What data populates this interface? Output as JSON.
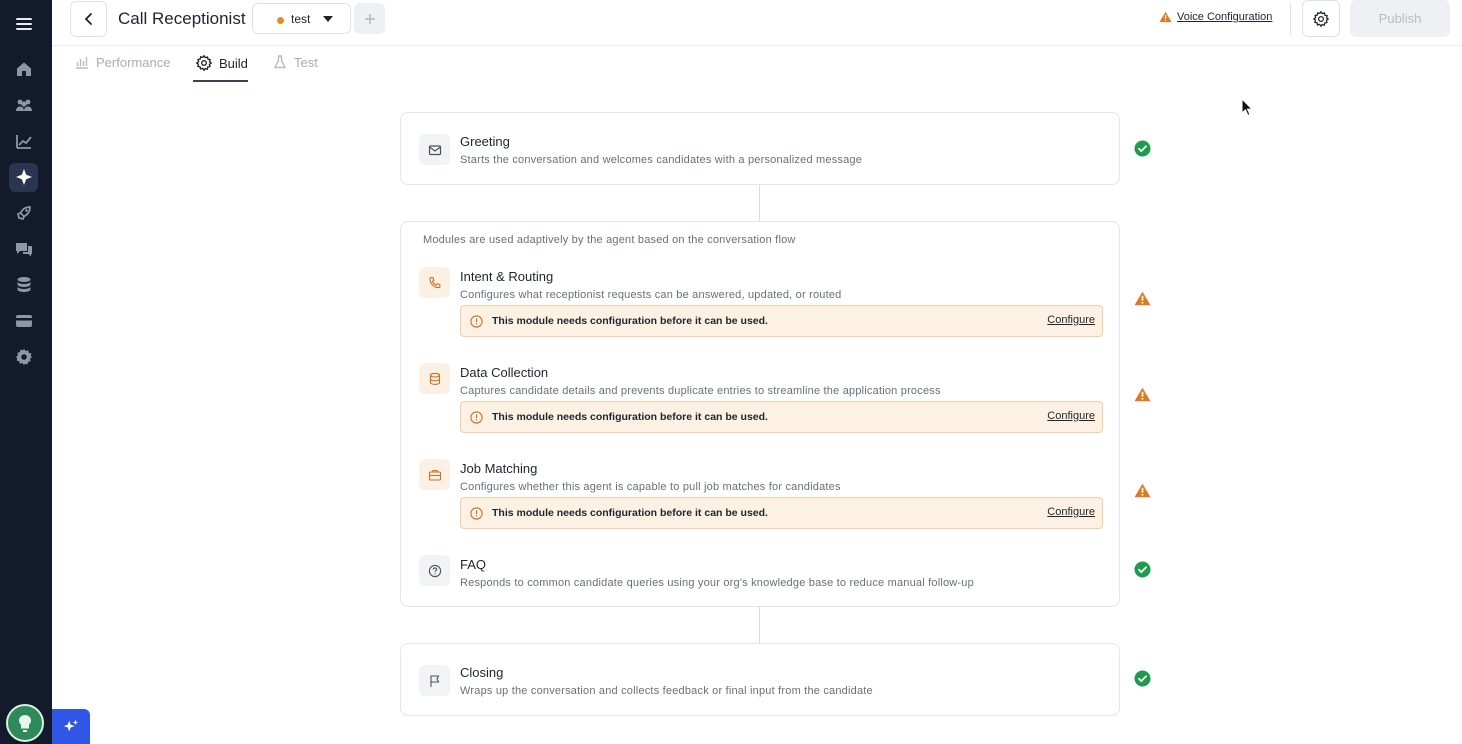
{
  "app": {
    "title": "Call Receptionist",
    "environment": "test",
    "voice_config_label": "Voice Configuration",
    "publish_label": "Publish"
  },
  "sidebar": {
    "items": [
      {
        "icon": "home-icon"
      },
      {
        "icon": "people-icon"
      },
      {
        "icon": "analytics-icon"
      },
      {
        "icon": "ai-agent-icon",
        "active": true
      },
      {
        "icon": "rocket-icon"
      },
      {
        "icon": "chat-icon"
      },
      {
        "icon": "database-icon"
      },
      {
        "icon": "card-icon"
      },
      {
        "icon": "settings-icon"
      }
    ]
  },
  "tabs": [
    {
      "label": "Performance",
      "active": false
    },
    {
      "label": "Build",
      "active": true
    },
    {
      "label": "Test",
      "active": false
    }
  ],
  "greeting": {
    "title": "Greeting",
    "description": "Starts the conversation and welcomes candidates with a personalized message",
    "status": "complete"
  },
  "modules_hint": "Modules are used adaptively by the agent based on the conversation flow",
  "modules": [
    {
      "title": "Intent & Routing",
      "description": "Configures what receptionist requests can be answered, updated, or routed",
      "warning": "This module needs configuration before it can be used.",
      "action": "Configure",
      "status": "warning"
    },
    {
      "title": "Data Collection",
      "description": "Captures candidate details and prevents duplicate entries to streamline the application process",
      "warning": "This module needs configuration before it can be used.",
      "action": "Configure",
      "status": "warning"
    },
    {
      "title": "Job Matching",
      "description": "Configures whether this agent is capable to pull job matches for candidates",
      "warning": "This module needs configuration before it can be used.",
      "action": "Configure",
      "status": "warning"
    },
    {
      "title": "FAQ",
      "description": "Responds to common candidate queries using your org's knowledge base to reduce manual follow-up",
      "status": "complete"
    }
  ],
  "closing": {
    "title": "Closing",
    "description": "Wraps up the conversation and collects feedback or final input from the candidate",
    "status": "complete"
  },
  "colors": {
    "sidebar_bg": "#121a2c",
    "warning": "#e07b1c",
    "success": "#1f9a4e",
    "accent": "#2f56e6"
  }
}
